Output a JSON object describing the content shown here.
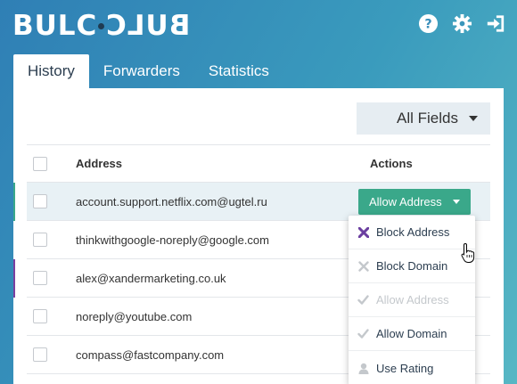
{
  "app": {
    "logo_left": "BULC",
    "logo_right": "BULC"
  },
  "tabs": [
    {
      "label": "History",
      "active": true
    },
    {
      "label": "Forwarders",
      "active": false
    },
    {
      "label": "Statistics",
      "active": false
    }
  ],
  "search": {
    "value": "",
    "placeholder": "",
    "field_selector": "All Fields"
  },
  "table": {
    "headers": {
      "address": "Address",
      "actions": "Actions"
    },
    "rows": [
      {
        "address": "account.support.netflix.com@ugtel.ru",
        "selected": true,
        "marker_color": "#3aa88a",
        "action": "Allow Address"
      },
      {
        "address": "thinkwithgoogle-noreply@google.com",
        "selected": false,
        "marker_color": "",
        "action": ""
      },
      {
        "address": "alex@xandermarketing.co.uk",
        "selected": false,
        "marker_color": "#7b3fa0",
        "action": ""
      },
      {
        "address": "noreply@youtube.com",
        "selected": false,
        "marker_color": "",
        "action": ""
      },
      {
        "address": "compass@fastcompany.com",
        "selected": false,
        "marker_color": "",
        "action": ""
      }
    ]
  },
  "dropdown": {
    "items": [
      {
        "label": "Block Address",
        "icon": "cross-icon",
        "color": "#6b3fa0",
        "disabled": false
      },
      {
        "label": "Block Domain",
        "icon": "cross-icon",
        "color": "#c4c8cc",
        "disabled": false
      },
      {
        "label": "Allow Address",
        "icon": "check-icon",
        "color": "#c4c8cc",
        "disabled": true
      },
      {
        "label": "Allow Domain",
        "icon": "check-icon",
        "color": "#c4c8cc",
        "disabled": false
      },
      {
        "label": "Use Rating",
        "icon": "person-icon",
        "color": "#c4c8cc",
        "disabled": false
      }
    ]
  },
  "colors": {
    "accent_green": "#3aa88a",
    "accent_purple": "#6b3fa0",
    "header_gradient_start": "#2f7fb5",
    "header_gradient_end": "#57b7c4"
  }
}
